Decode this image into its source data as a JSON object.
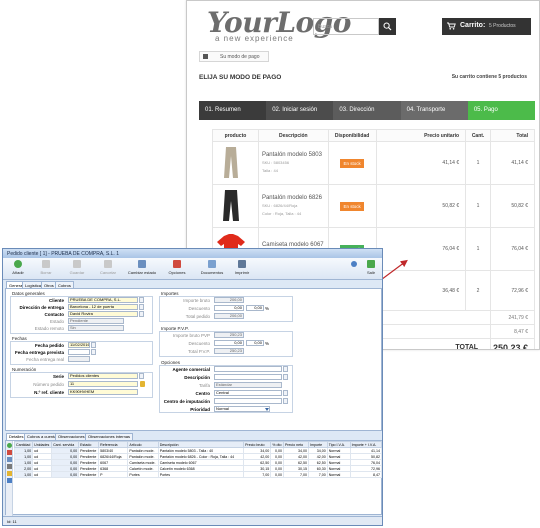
{
  "shop": {
    "logo_main": "YourLogo",
    "logo_tagline": "a new experience",
    "search_placeholder": "Busca",
    "cart_label": "Carrito:",
    "cart_value": "5 Productos",
    "breadcrumb": "Su modo de pago",
    "page_title": "ELIJA SU MODO DE PAGO",
    "cart_summary": "Su carrito contiene 5 productos",
    "steps": [
      "01. Resumen",
      "02. Iniciar sesión",
      "03. Dirección",
      "04. Transporte",
      "05. Pago"
    ],
    "table_headers": [
      "producto",
      "Descripción",
      "Disponibilidad",
      "Precio unitario",
      "Cant.",
      "Total"
    ],
    "products": [
      {
        "name": "Pantalón modelo 5803",
        "meta1": "SKU : 5803456",
        "meta2": "Talla : 44",
        "stock": "En stock",
        "stock_color": "#f0862e",
        "unit": "41,14 €",
        "qty": "1",
        "total": "41,14 €"
      },
      {
        "name": "Pantalón modelo 6826",
        "meta1": "SKU : 6826/44/Roja",
        "meta2": "Color : Roja, Talla : 44",
        "stock": "En stock",
        "stock_color": "#f0862e",
        "unit": "50,82 €",
        "qty": "1",
        "total": "50,82 €"
      },
      {
        "name": "Camiseta modelo 6067",
        "meta1": "SKU : 6067",
        "meta2": "",
        "stock": "En stock",
        "stock_color": "#46b15a",
        "unit": "76,04 €",
        "qty": "1",
        "total": "76,04 €"
      },
      {
        "name": "",
        "meta1": "",
        "meta2": "",
        "stock": "",
        "stock_color": "#46b15a",
        "unit": "36,48 €",
        "qty": "2",
        "total": "72,96 €"
      }
    ],
    "totals": [
      {
        "label": "Total productos (impuestos inc.)",
        "value": "241,79 €"
      },
      {
        "label": "gastos de envío (impuestos inc.)",
        "value": "8,47 €"
      },
      {
        "label": "TOTAL",
        "value": "250,23 €"
      }
    ]
  },
  "erp": {
    "title": "Pedido cliente [ 1] - PRUEBA DE COMPRA, S.L. 1",
    "toolbar": [
      "Añadir",
      "Borrar",
      "Guardar",
      "Cancelar",
      "Cambiar estado",
      "Opciones",
      "Documentos",
      "Imprimir",
      "Salir"
    ],
    "tabs": [
      "General",
      "Logística",
      "Otros",
      "Cobros"
    ],
    "datos_generales_title": "Datos generales",
    "labels": {
      "cliente": "Cliente",
      "direccion": "Dirección de entrega",
      "contacto": "Contacto",
      "estado": "Estado",
      "estado_remoto": "Estado remoto",
      "fechas_title": "Fechas",
      "fecha_pedido": "Fecha pedido",
      "fecha_prevista": "Fecha entrega prevista",
      "fecha_real": "Fecha entrega real",
      "numeracion_title": "Numeración",
      "serie": "Serie",
      "numero": "Número pedido",
      "ref_cliente": "N.º ref. cliente",
      "importes_title": "Importes",
      "importe_bruto": "Importe bruto",
      "descuento": "Descuento",
      "total_pedido": "Total pedido",
      "importe_pvp_title": "Importe P.V.P.",
      "importe_bruto_pvp": "Importe bruto PVP",
      "descuento_pvp": "Descuento",
      "total_pvp": "Total P.V.P.",
      "opciones_title": "Opciones",
      "agente": "Agente comercial",
      "descripcion": "Descripción",
      "tarifa": "Tarifa",
      "centro": "Centro",
      "centro_imputacion": "Centro de imputación",
      "prioridad": "Prioridad"
    },
    "values": {
      "cliente": "PRUEBA DE COMPRA, S.L.",
      "direccion": "Barcelona - 12 de puerta",
      "contacto": "David Rovira",
      "estado": "Pendiente",
      "estado_remoto": "Sin",
      "fecha_pedido": "11/02/2016",
      "serie": "Pedidos clientes",
      "numero": "11",
      "ref_cliente": "KK90HVHEM",
      "importe_bruto": "206,00",
      "descuento_pct": "0,00",
      "descuento": "0,00",
      "total_pedido": "206,00",
      "importe_bruto_pvp": "250,23",
      "descuento_pvp_pct": "0,00",
      "descuento_pvp": "0,00",
      "total_pvp": "250,23",
      "tarifa": "Estándar",
      "centro": "Central",
      "prioridad": "Normal",
      "percent": "%"
    },
    "detail_tabs": [
      "Detalles",
      "Cobros a cuenta",
      "Observaciones",
      "Observaciones internas"
    ],
    "line_headers": [
      "Cantidad",
      "Unidades",
      "Cant. servida",
      "Estado",
      "Referencia",
      "Artículo",
      "Descripción",
      "Precio bruto",
      "% dto",
      "Precio neto",
      "Importe",
      "Tipo I.V.A.",
      "Importe + I.V.A."
    ],
    "lines": [
      [
        "1,00",
        "ud",
        "0,00",
        "Pendiente",
        "5803/40",
        "Pantalón mode.",
        "Pantalón modelo 5803 - Talla : 40",
        "34,00",
        "0,00",
        "34,00",
        "34,00",
        "Normal",
        "41,14"
      ],
      [
        "1,00",
        "ud",
        "0,00",
        "Pendiente",
        "6826/44/Roja",
        "Pantalón mode.",
        "Pantalón modelo 6826 - Color : Roja, Talla : 44",
        "42,00",
        "0,00",
        "42,00",
        "42,00",
        "Normal",
        "50,82"
      ],
      [
        "1,00",
        "ud",
        "0,00",
        "Pendiente",
        "6067",
        "Camiseta mode.",
        "Camiseta modelo 6067",
        "62,50",
        "0,00",
        "62,50",
        "62,50",
        "Normal",
        "76,04"
      ],
      [
        "2,00",
        "ud",
        "0,00",
        "Pendiente",
        "6368",
        "Calcetín mode.",
        "Calcetín modelo 6368",
        "30,15",
        "0,00",
        "30,15",
        "60,30",
        "Normal",
        "72,96"
      ],
      [
        "1,00",
        "ud",
        "0,00",
        "Pendiente",
        "P",
        "Portes",
        "Portes",
        "7,00",
        "0,00",
        "7,00",
        "7,00",
        "Normal",
        "8,47"
      ]
    ],
    "status": "Id: 11"
  }
}
